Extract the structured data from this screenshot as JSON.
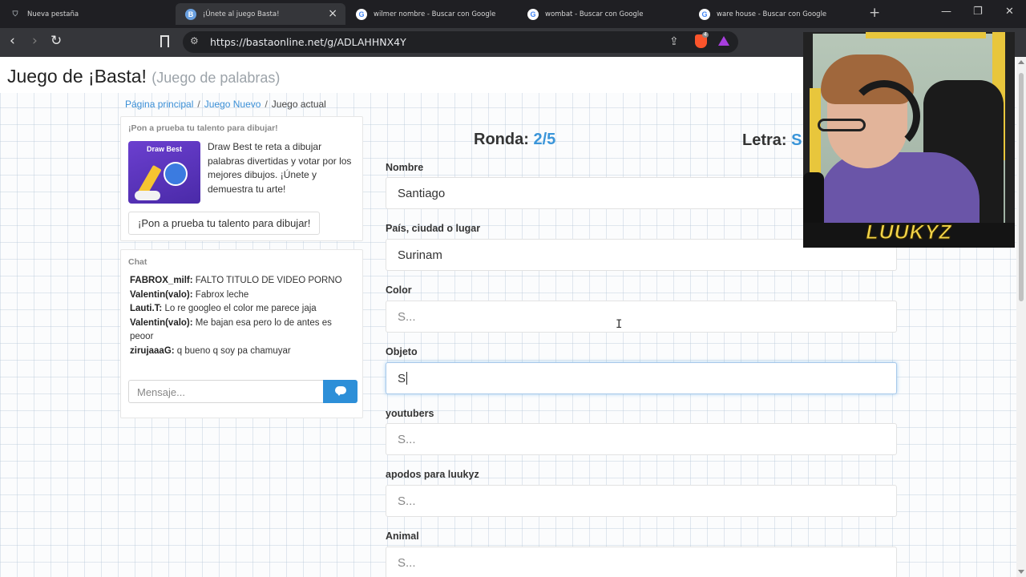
{
  "browser": {
    "tabs": [
      {
        "title": "Nueva pestaña",
        "icon": "shield-icon",
        "active": false
      },
      {
        "title": "¡Únete al juego Basta!",
        "icon": "basta-icon",
        "active": true
      },
      {
        "title": "wilmer nombre - Buscar con Google",
        "icon": "google-icon",
        "active": false
      },
      {
        "title": "wombat - Buscar con Google",
        "icon": "google-icon",
        "active": false
      },
      {
        "title": "ware house - Buscar con Google",
        "icon": "google-icon",
        "active": false
      }
    ],
    "new_tab_symbol": "+",
    "window_controls": {
      "minimize": "—",
      "maximize": "❐",
      "close": "✕"
    },
    "tab_close_symbol": "×",
    "url": "https://bastaonline.net/g/ADLAHHNX4Y",
    "brave_badge": "4",
    "nav": {
      "back": "‹",
      "forward": "›",
      "reload": "↻"
    }
  },
  "header": {
    "title": "Juego de ¡Basta!",
    "subtitle": "(Juego de palabras)"
  },
  "breadcrumb": {
    "home": "Página principal",
    "sep": "/",
    "new_game": "Juego Nuevo",
    "current": "Juego actual"
  },
  "ad": {
    "heading": "¡Pon a prueba tu talento para dibujar!",
    "image_label": "Draw Best",
    "text": "Draw Best te reta a dibujar palabras divertidas y votar por los mejores dibujos. ¡Únete y demuestra tu arte!",
    "button": "¡Pon a prueba tu talento para dibujar!"
  },
  "chat": {
    "heading": "Chat",
    "messages": [
      {
        "user": "FABROX_milf:",
        "text": " FALTO TITULO DE VIDEO PORNO"
      },
      {
        "user": "Valentin(valo):",
        "text": " Fabrox leche"
      },
      {
        "user": "Lauti.T:",
        "text": " Lo re googleo el color me parece jaja"
      },
      {
        "user": "Valentin(valo):",
        "text": " Me bajan esa pero lo de antes es peoor"
      },
      {
        "user": "zirujaaaG:",
        "text": " q bueno q soy pa chamuyar"
      }
    ],
    "input_placeholder": "Mensaje..."
  },
  "game": {
    "round_label": "Ronda:",
    "round_value": "2/5",
    "letter_label": "Letra:",
    "letter_value": "S",
    "fields": [
      {
        "label": "Nombre",
        "value": "Santiago",
        "placeholder": ""
      },
      {
        "label": "País, ciudad o lugar",
        "value": "Surinam",
        "placeholder": ""
      },
      {
        "label": "Color",
        "value": "",
        "placeholder": "S..."
      },
      {
        "label": "Objeto",
        "value": "S",
        "placeholder": ""
      },
      {
        "label": "youtubers",
        "value": "",
        "placeholder": "S..."
      },
      {
        "label": "apodos para luukyz",
        "value": "",
        "placeholder": "S..."
      },
      {
        "label": "Animal",
        "value": "",
        "placeholder": "S..."
      }
    ]
  },
  "webcam": {
    "name": "LUUKYZ"
  },
  "colors": {
    "link": "#3b8fd6",
    "accent": "#3a95d9",
    "send_button": "#2d8fd8",
    "webcam_name": "#f3d54a"
  }
}
